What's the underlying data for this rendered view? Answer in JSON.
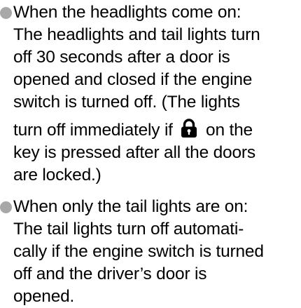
{
  "bullets": [
    {
      "lines": [
        "When the headlights come on:",
        "The headlights and tail lights turn",
        "off 30 seconds after a door is",
        "opened and closed if the engine",
        "switch is turned off. (The lights"
      ],
      "lock_line": {
        "before": "turn off immediately if",
        "icon": "lock-icon",
        "after": "on the"
      },
      "tail_lines": [
        "key is pressed after all the doors",
        "are locked.)"
      ]
    },
    {
      "lines": [
        "When only the tail lights are on:",
        "The tail lights turn off automati-",
        "cally if the engine switch is turned",
        "off and the driver’s door is",
        "opened."
      ]
    }
  ]
}
